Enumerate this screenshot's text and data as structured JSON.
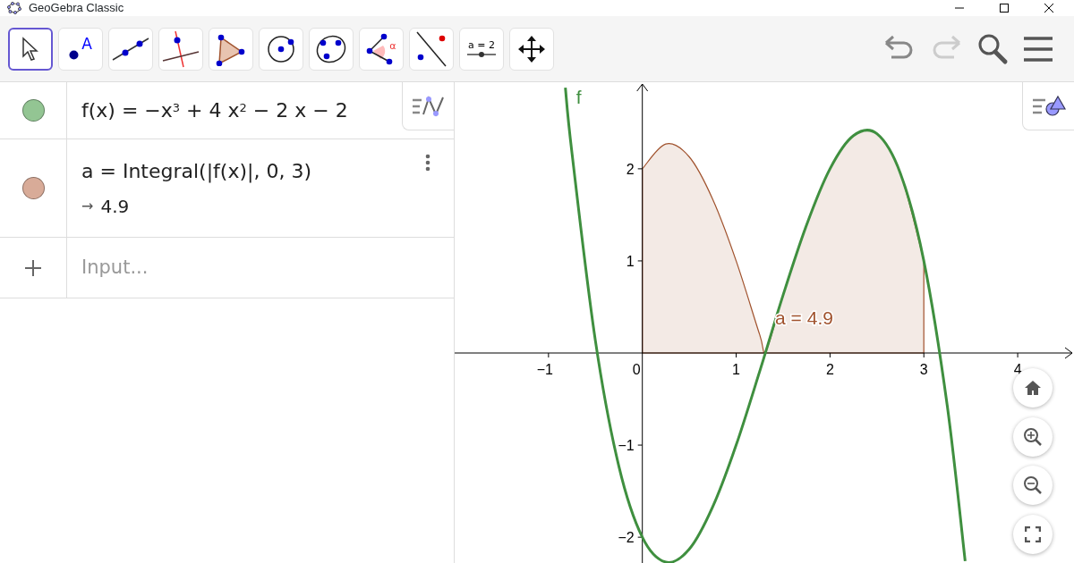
{
  "window": {
    "title": "GeoGebra Classic"
  },
  "tools": [
    {
      "kind": "move",
      "selected": true
    },
    {
      "kind": "point",
      "label": "A",
      "selected": false
    },
    {
      "kind": "line",
      "selected": false
    },
    {
      "kind": "perpendicular",
      "selected": false
    },
    {
      "kind": "polygon",
      "selected": false
    },
    {
      "kind": "circle",
      "selected": false
    },
    {
      "kind": "conic",
      "selected": false
    },
    {
      "kind": "angle",
      "label": "α",
      "selected": false
    },
    {
      "kind": "reflect",
      "selected": false
    },
    {
      "kind": "slider",
      "label": "a = 2",
      "selected": false
    },
    {
      "kind": "move-view",
      "selected": false
    }
  ],
  "algebra": {
    "rows": [
      {
        "color": "#93c593",
        "definition": "f(x) = −x$^{3}$ + 4 x$^{2}$ − 2 x − 2"
      },
      {
        "color": "#d8ab98",
        "definition": "a = Integral(|f(x)|, 0, 3)",
        "arrow": "→",
        "value": "4.9"
      }
    ],
    "input": {
      "placeholder": "Input..."
    }
  },
  "graphics": {
    "chart_data": {
      "type": "line",
      "xlim": [
        -2,
        4.6
      ],
      "ylim": [
        -2.28,
        2.94
      ],
      "xticks": [
        {
          "value": -1,
          "label": "−1"
        },
        {
          "value": 0,
          "label": "0"
        },
        {
          "value": 1,
          "label": "1"
        },
        {
          "value": 2,
          "label": "2"
        },
        {
          "value": 3,
          "label": "3"
        },
        {
          "value": 4,
          "label": "4"
        }
      ],
      "yticks": [
        {
          "value": -2,
          "label": "−2"
        },
        {
          "value": -1,
          "label": "−1"
        },
        {
          "value": 1,
          "label": "1"
        },
        {
          "value": 2,
          "label": "2"
        }
      ],
      "x": [
        -0.82,
        -0.75,
        -0.5,
        -0.25,
        0,
        0.25,
        0.5,
        0.75,
        1,
        1.25,
        1.32,
        1.5,
        1.75,
        2,
        2.25,
        2.5,
        2.75,
        3,
        3.25,
        3.44
      ],
      "series": [
        {
          "name": "a = 4.9",
          "type": "area",
          "color": "#a0522d",
          "values": [
            null,
            null,
            null,
            null,
            2,
            2.27,
            2.13,
            1.67,
            1,
            0.2,
            0.03,
            0.63,
            1.39,
            2,
            2.36,
            2.38,
            1.95,
            1,
            null,
            null
          ]
        },
        {
          "name": "f",
          "type": "line",
          "color": "#3f8f3f",
          "values": [
            2.88,
            2.17,
            0.13,
            -1.23,
            -2,
            -2.27,
            -2.13,
            -1.67,
            -1,
            -0.2,
            0.03,
            0.63,
            1.39,
            2,
            2.36,
            2.38,
            1.95,
            1,
            -0.58,
            -2.26
          ]
        }
      ]
    }
  }
}
